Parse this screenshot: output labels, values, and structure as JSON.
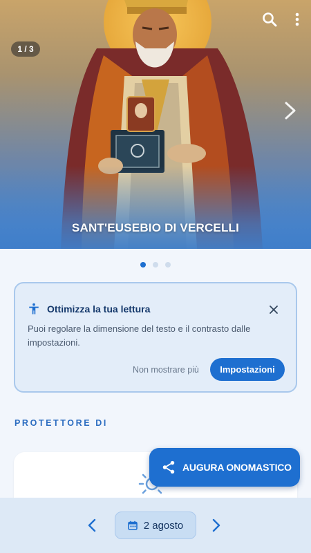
{
  "hero": {
    "counter": "1 / 3",
    "title": "SANT'EUSEBIO DI VERCELLI",
    "icons": [
      "search-icon",
      "more-vert-icon",
      "chevron-right-icon"
    ],
    "carousel": {
      "current": 1,
      "total": 3
    }
  },
  "info_card": {
    "title": "Ottimizza la tua lettura",
    "body": "Puoi regolare la dimensione del testo e il contrasto dalle impostazioni.",
    "dismiss_label": "Non mostrare più",
    "settings_label": "Impostazioni",
    "icons": [
      "accessibility-icon",
      "close-icon"
    ]
  },
  "section": {
    "label": "PROTETTORE DI",
    "card_icon": "sun-icon"
  },
  "fab": {
    "label": "AUGURA ONOMASTICO",
    "icon": "share-icon"
  },
  "bottom_bar": {
    "date_label": "2 agosto",
    "icons": [
      "chevron-left-icon",
      "calendar-icon",
      "chevron-right-icon"
    ]
  },
  "colors": {
    "accent": "#1e6fd0",
    "background": "#f2f6fc",
    "card_tint": "#e3edf9",
    "bottom_bar": "#dde9f6"
  }
}
